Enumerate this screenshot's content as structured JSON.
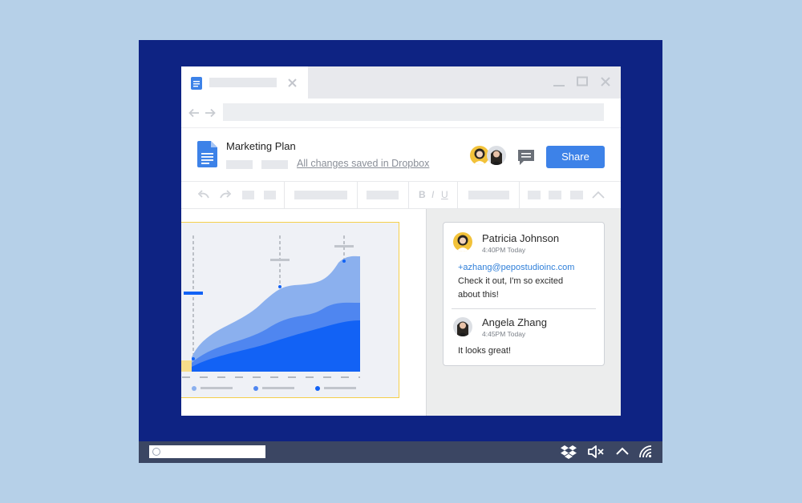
{
  "document": {
    "title": "Marketing Plan",
    "save_status": "All changes saved in Dropbox",
    "share_label": "Share"
  },
  "toolbar": {
    "bold": "B",
    "italic": "I",
    "underline": "U"
  },
  "comments": [
    {
      "author": "Patricia Johnson",
      "time": "4:40PM Today",
      "mention": "+azhang@pepostudioinc.com",
      "text_line1": "Check it out, I'm so excited",
      "text_line2": "about this!"
    },
    {
      "author": "Angela Zhang",
      "time": "4:45PM Today",
      "text_line1": "It looks great!"
    }
  ],
  "colors": {
    "desktop": "#0e2383",
    "taskbar": "#3b4663",
    "share_button": "#3d82e8",
    "chart_light": "#8bb0ee",
    "chart_mid": "#4f86f0",
    "chart_dark": "#1262f5",
    "highlight": "#f5cf4a"
  },
  "icons": [
    "docs-icon",
    "close-icon",
    "minimize-icon",
    "maximize-icon",
    "back-icon",
    "forward-icon",
    "comment-icon",
    "undo-icon",
    "redo-icon",
    "dropbox-icon",
    "mute-icon",
    "chevron-up-icon",
    "wifi-icon"
  ]
}
